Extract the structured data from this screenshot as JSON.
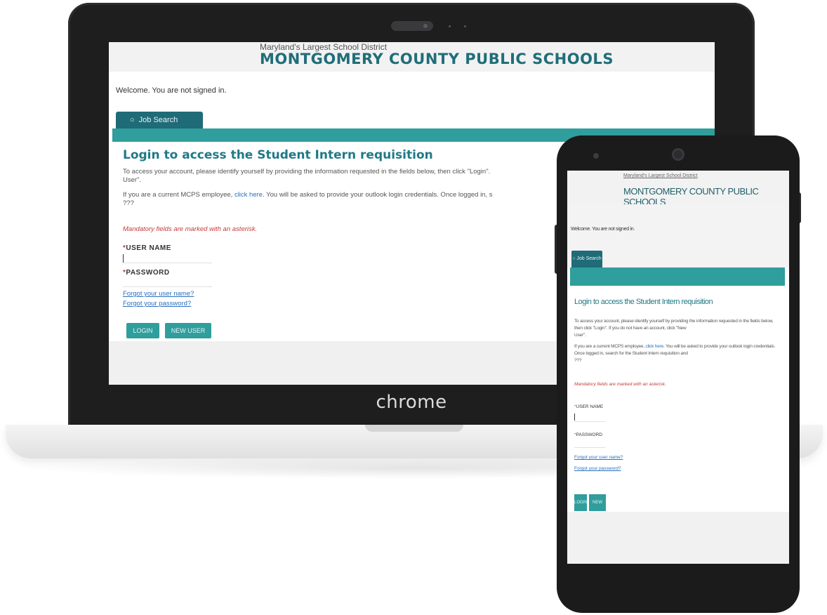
{
  "laptop": {
    "brand": "chrome",
    "page": {
      "tagline": "Maryland's Largest School District",
      "title": "MONTGOMERY COUNTY PUBLIC SCHOOLS",
      "welcome": "Welcome. You are not signed in.",
      "tab_label": "Job Search",
      "tab_icon": "search-icon",
      "heading": "Login to access the Student Intern requisition",
      "para1": "To access your account, please identify yourself by providing the information requested in the fields below, then click \"Login\".",
      "para1_cont": "User\".",
      "para2_prefix": "If you are a current MCPS employee,",
      "para2_link": "click here",
      "para2_suffix": ". You will be asked to provide your outlook login credentials. Once logged in, s",
      "para2_cont": "???",
      "mandatory_note": "Mandatory fields are marked with an asterisk.",
      "username_label": "USER NAME",
      "password_label": "PASSWORD",
      "forgot_username": "Forgot your user name?",
      "forgot_password": "Forgot your password?",
      "login_button": "LOGIN",
      "new_user_button": "NEW USER"
    }
  },
  "phone": {
    "page": {
      "tagline": "Maryland's Largest School District",
      "title": "MONTGOMERY COUNTY PUBLIC SCHOOLS",
      "welcome": "Welcome. You are not signed in.",
      "tab_label": "Job Search",
      "heading": "Login to access the Student Intern requisition",
      "para1": "To access your account, please identify yourself by providing the information requested in the fields below, then click \"Login\". If you do not have an account, click \"New",
      "para1_cont": "User\".",
      "para2_prefix": "If you are a current MCPS employee,",
      "para2_link": "click here",
      "para2_suffix": ". You will be asked to provide your outlook login credentials. Once logged in, search for the Student Intern requisition and",
      "para2_cont": "???",
      "mandatory_note": "Mandatory fields are marked with an asterisk.",
      "username_label": "USER NAME",
      "password_label": "PASSWORD",
      "forgot_username": "Forgot your user name?",
      "forgot_password": "Forgot your password?",
      "login_button": "LOGIN",
      "new_user_button": "NEW USER"
    }
  },
  "colors": {
    "teal": "#2f9e9c",
    "dark_teal": "#1f6b78",
    "title": "#1f6e78",
    "link": "#2a6fbf",
    "mandatory": "#c73a3a"
  }
}
